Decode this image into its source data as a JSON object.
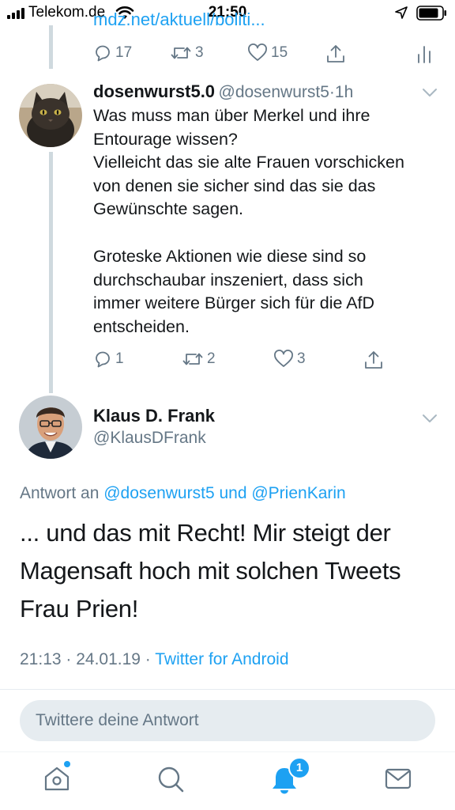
{
  "status_bar": {
    "carrier": "Telekom.de",
    "time": "21:50"
  },
  "previous_tweet": {
    "link_fragment": "mdz.net/aktuell/politi...",
    "replies": "17",
    "retweets": "3",
    "likes": "15"
  },
  "parent_tweet": {
    "author_name": "dosenwurst5.0",
    "author_handle": "@dosenwurst5",
    "separator": "·",
    "time_ago": "1h",
    "text_part1": "Was muss man über Merkel und ihre\nEntourage wissen?\nVielleicht das sie alte Frauen vorschicken\nvon denen sie sicher sind das sie das\nGewünschte sagen.",
    "text_part2": "Groteske Aktionen wie diese sind so\ndurchschaubar inszeniert, dass sich\nimmer weitere Bürger sich für die AfD\nentscheiden.",
    "replies": "1",
    "retweets": "2",
    "likes": "3"
  },
  "main_tweet": {
    "author_name": "Klaus D. Frank",
    "author_handle": "@KlausDFrank",
    "reply_prefix": "Antwort an",
    "reply_user1": "@dosenwurst5",
    "reply_and": "und",
    "reply_user2": "@PrienKarin",
    "text": "... und das mit Recht! Mir steigt der\nMagensaft hoch mit solchen Tweets\nFrau Prien!",
    "timestamp": "21:13 · 24.01.19 ·",
    "source": "Twitter for Android"
  },
  "compose": {
    "placeholder": "Twittere deine Antwort"
  },
  "tab_bar": {
    "notifications_badge": "1"
  },
  "colors": {
    "accent": "#1da1f2",
    "secondary_text": "#657786",
    "primary_text": "#14171a"
  }
}
